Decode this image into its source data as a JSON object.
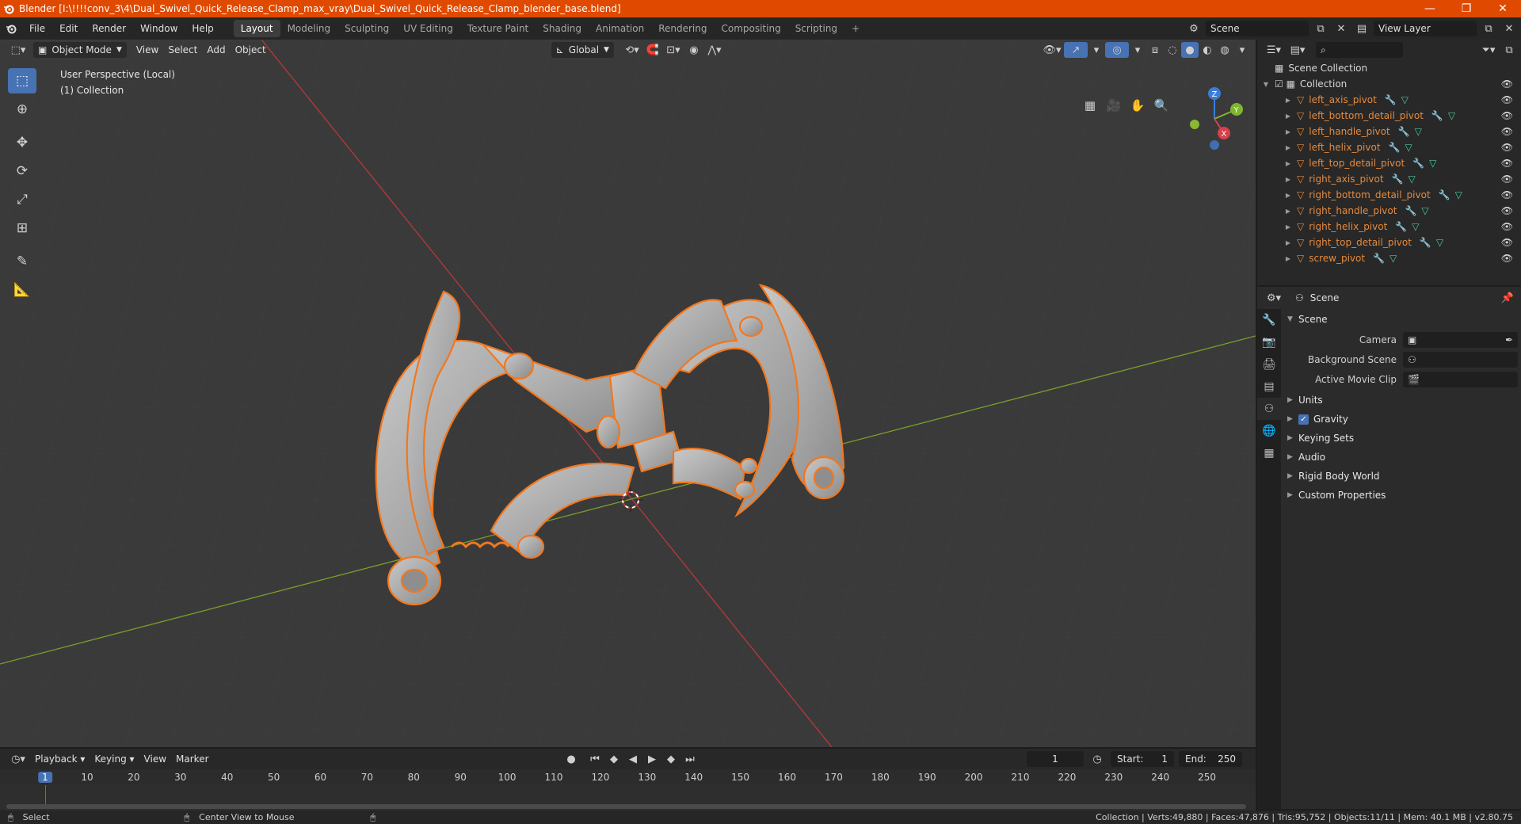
{
  "titlebar": {
    "title": "Blender [I:\\!!!!conv_3\\4\\Dual_Swivel_Quick_Release_Clamp_max_vray\\Dual_Swivel_Quick_Release_Clamp_blender_base.blend]",
    "minimize": "—",
    "maximize": "❐",
    "close": "✕"
  },
  "menu": [
    "File",
    "Edit",
    "Render",
    "Window",
    "Help"
  ],
  "workspaces": [
    "Layout",
    "Modeling",
    "Sculpting",
    "UV Editing",
    "Texture Paint",
    "Shading",
    "Animation",
    "Rendering",
    "Compositing",
    "Scripting"
  ],
  "workspace_add": "+",
  "scene_selector": "Scene",
  "view_layer_selector": "View Layer",
  "viewport": {
    "mode": "Object Mode",
    "menus": [
      "View",
      "Select",
      "Add",
      "Object"
    ],
    "orientation": "Global",
    "info_line1": "User Perspective (Local)",
    "info_line2": "(1) Collection",
    "gizmo": {
      "x": "X",
      "y": "Y",
      "z": "Z"
    }
  },
  "timeline": {
    "menus": [
      "Playback",
      "Keying",
      "View",
      "Marker"
    ],
    "current_frame": "1",
    "start_label": "Start:",
    "start_value": "1",
    "end_label": "End:",
    "end_value": "250",
    "ticks": [
      "1",
      "10",
      "20",
      "30",
      "40",
      "50",
      "60",
      "70",
      "80",
      "90",
      "100",
      "110",
      "120",
      "130",
      "140",
      "150",
      "160",
      "170",
      "180",
      "190",
      "200",
      "210",
      "220",
      "230",
      "240",
      "250"
    ]
  },
  "outliner": {
    "root": "Scene Collection",
    "collection": "Collection",
    "objects": [
      "left_axis_pivot",
      "left_bottom_detail_pivot",
      "left_handle_pivot",
      "left_helix_pivot",
      "left_top_detail_pivot",
      "right_axis_pivot",
      "right_bottom_detail_pivot",
      "right_handle_pivot",
      "right_helix_pivot",
      "right_top_detail_pivot",
      "screw_pivot"
    ]
  },
  "properties": {
    "context": "Scene",
    "panel_title": "Scene",
    "fields": [
      {
        "label": "Camera",
        "value": ""
      },
      {
        "label": "Background Scene",
        "value": ""
      },
      {
        "label": "Active Movie Clip",
        "value": ""
      }
    ],
    "subpanels": [
      "Units",
      "Gravity",
      "Keying Sets",
      "Audio",
      "Rigid Body World",
      "Custom Properties"
    ]
  },
  "statusbar": {
    "left_action": "Select",
    "middle_action": "Center View to Mouse",
    "stats": "Collection | Verts:49,880 | Faces:47,876 | Tris:95,752 | Objects:11/11 | Mem: 40.1 MB | v2.80.75"
  },
  "colors": {
    "accent": "#4772b3",
    "selection_outline": "#f2771e",
    "title_bar": "#e04a00",
    "x_axis": "#c0393f",
    "y_axis": "#7a9e2a"
  }
}
